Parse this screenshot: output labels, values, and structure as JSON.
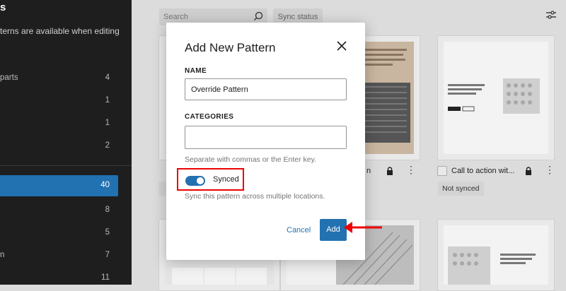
{
  "sidebar": {
    "title": "s",
    "description": "terns are available when editing",
    "items": [
      {
        "label": "parts",
        "count": "4"
      },
      {
        "label": "",
        "count": "1"
      },
      {
        "label": "",
        "count": "1"
      },
      {
        "label": "",
        "count": "2"
      },
      {
        "label": "",
        "count": "40",
        "active": true
      },
      {
        "label": "",
        "count": "8"
      },
      {
        "label": "",
        "count": "5"
      },
      {
        "label": "n",
        "count": "7"
      },
      {
        "label": "",
        "count": "11"
      }
    ]
  },
  "toolbar": {
    "search_placeholder": "Search",
    "sync_status_label": "Sync status"
  },
  "cards": [
    {
      "name": "",
      "badge": ""
    },
    {
      "name": "n",
      "badge": ""
    },
    {
      "name": "Call to action wit...",
      "badge": "Not synced"
    }
  ],
  "modal": {
    "title": "Add New Pattern",
    "name_label": "NAME",
    "name_value": "Override Pattern",
    "categories_label": "CATEGORIES",
    "categories_value": "",
    "categories_help": "Separate with commas or the Enter key.",
    "sync_label": "Synced",
    "sync_on": true,
    "sync_help": "Sync this pattern across multiple locations.",
    "cancel_label": "Cancel",
    "add_label": "Add"
  },
  "colors": {
    "accent": "#2271b1",
    "highlight": "#e00000",
    "sidebar_bg": "#1e1e1e"
  }
}
